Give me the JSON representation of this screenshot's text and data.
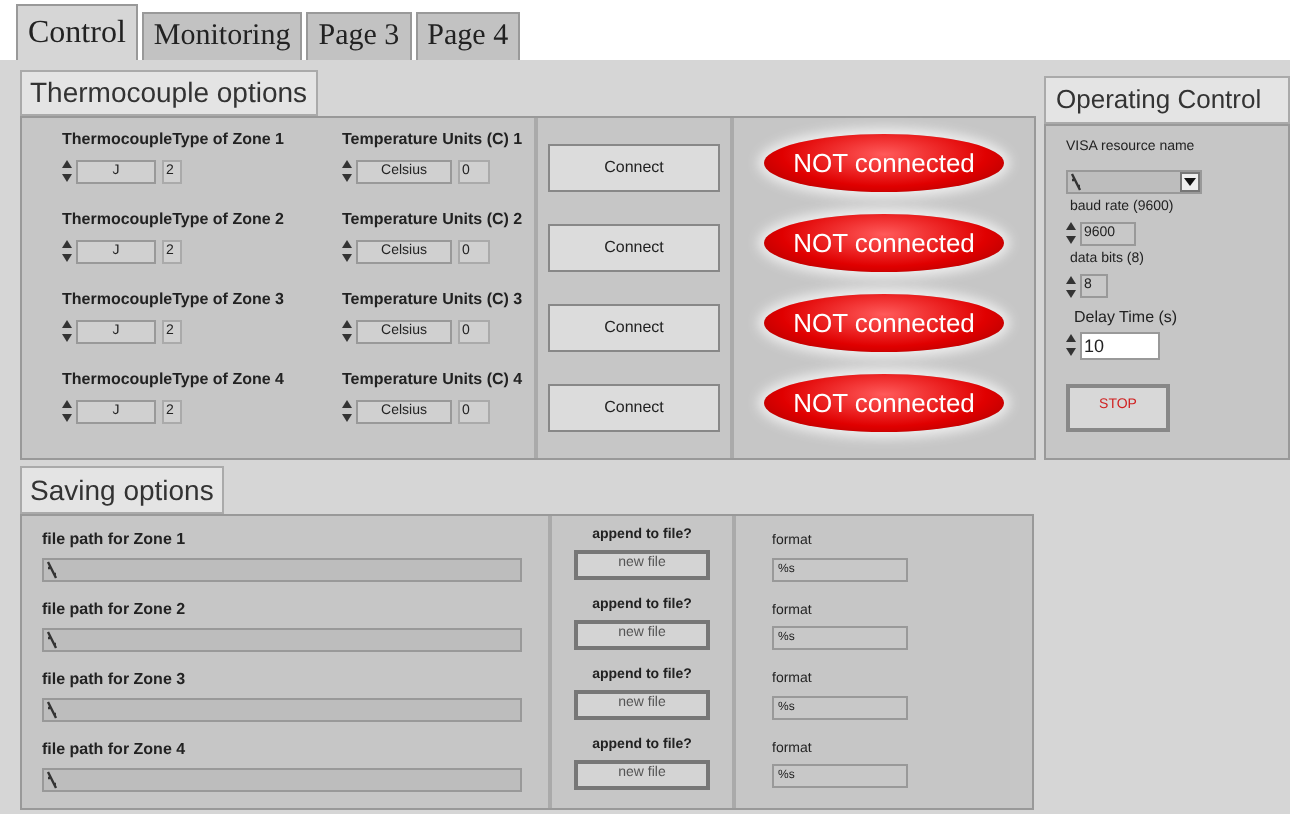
{
  "tabs": [
    {
      "label": "Control",
      "selected": true
    },
    {
      "label": "Monitoring",
      "selected": false
    },
    {
      "label": "Page 3",
      "selected": false
    },
    {
      "label": "Page 4",
      "selected": false
    }
  ],
  "thermocouple": {
    "title": "Thermocouple options",
    "zones": [
      {
        "type_label": "ThermocoupleType of Zone 1",
        "type_value": "J",
        "type_index": "2",
        "units_label": "Temperature Units (C) 1",
        "units_value": "Celsius",
        "units_index": "0",
        "connect": "Connect",
        "status": "NOT connected"
      },
      {
        "type_label": "ThermocoupleType of Zone 2",
        "type_value": "J",
        "type_index": "2",
        "units_label": "Temperature Units (C) 2",
        "units_value": "Celsius",
        "units_index": "0",
        "connect": "Connect",
        "status": "NOT connected"
      },
      {
        "type_label": "ThermocoupleType of Zone 3",
        "type_value": "J",
        "type_index": "2",
        "units_label": "Temperature Units (C) 3",
        "units_value": "Celsius",
        "units_index": "0",
        "connect": "Connect",
        "status": "NOT connected"
      },
      {
        "type_label": "ThermocoupleType of Zone 4",
        "type_value": "J",
        "type_index": "2",
        "units_label": "Temperature Units (C) 4",
        "units_value": "Celsius",
        "units_index": "0",
        "connect": "Connect",
        "status": "NOT connected"
      }
    ]
  },
  "operating": {
    "title": "Operating Control",
    "visa_label": "VISA resource name",
    "baud_label": "baud rate (9600)",
    "baud_value": "9600",
    "bits_label": "data bits (8)",
    "bits_value": "8",
    "delay_label": "Delay Time (s)",
    "delay_value": "10",
    "stop": "STOP"
  },
  "saving": {
    "title": "Saving options",
    "rows": [
      {
        "path_label": "file path for Zone 1",
        "append_label": "append to file?",
        "button": "new file",
        "format_label": "format",
        "format_value": "%s"
      },
      {
        "path_label": "file path for Zone 2",
        "append_label": "append to file?",
        "button": "new file",
        "format_label": "format",
        "format_value": "%s"
      },
      {
        "path_label": "file path for Zone 3",
        "append_label": "append to file?",
        "button": "new file",
        "format_label": "format",
        "format_value": "%s"
      },
      {
        "path_label": "file path for Zone 4",
        "append_label": "append to file?",
        "button": "new file",
        "format_label": "format",
        "format_value": "%s"
      }
    ]
  }
}
